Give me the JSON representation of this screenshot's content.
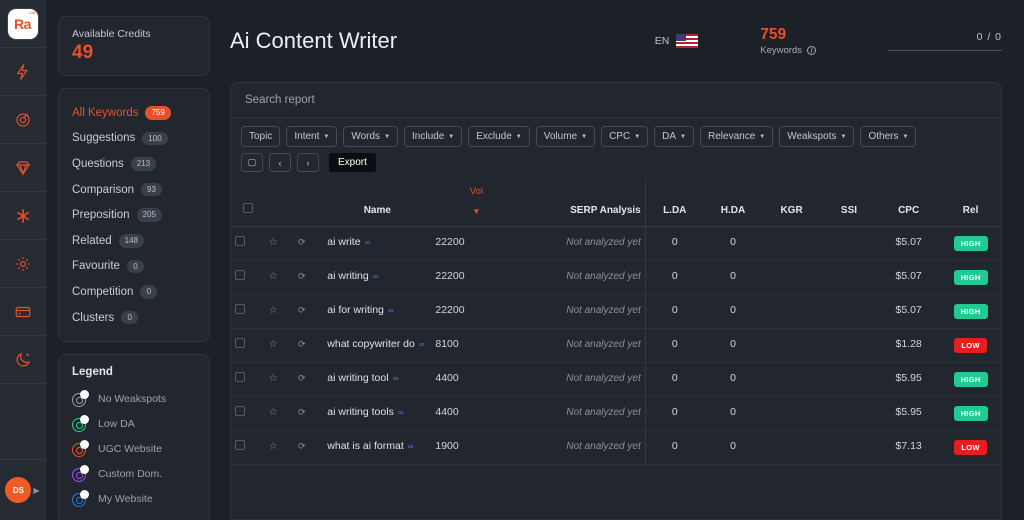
{
  "rail": {
    "logo_text": "Ra",
    "logo_sup": "LAB",
    "avatar_initials": "DS",
    "icons": [
      "bolt-icon",
      "target-icon",
      "diamond-icon",
      "asterisk-icon",
      "gear-icon",
      "card-icon",
      "moon-icon"
    ]
  },
  "credits": {
    "label": "Available Credits",
    "value": "49"
  },
  "nav": {
    "items": [
      {
        "label": "All Keywords",
        "count": "759",
        "active": true
      },
      {
        "label": "Suggestions",
        "count": "100",
        "active": false
      },
      {
        "label": "Questions",
        "count": "213",
        "active": false
      },
      {
        "label": "Comparison",
        "count": "93",
        "active": false
      },
      {
        "label": "Preposition",
        "count": "205",
        "active": false
      },
      {
        "label": "Related",
        "count": "148",
        "active": false
      },
      {
        "label": "Favourite",
        "count": "0",
        "active": false
      },
      {
        "label": "Competition",
        "count": "0",
        "active": false
      },
      {
        "label": "Clusters",
        "count": "0",
        "active": false
      }
    ]
  },
  "legend": {
    "title": "Legend",
    "items": [
      {
        "label": "No Weakspots",
        "color": "#9aa0a8",
        "letter": "0"
      },
      {
        "label": "Low DA",
        "color": "#1fd68f",
        "letter": "0"
      },
      {
        "label": "UGC Website",
        "color": "#f0502a",
        "letter": "0"
      },
      {
        "label": "Custom Dom.",
        "color": "#9b4ff5",
        "letter": "0"
      },
      {
        "label": "My Website",
        "color": "#2f6fe0",
        "letter": "0"
      }
    ]
  },
  "header": {
    "title": "Ai Content Writer",
    "lang_code": "EN",
    "flag": "us-flag-icon",
    "keywords_count": "759",
    "keywords_label": "Keywords",
    "progress_text": "0 / 0"
  },
  "search": {
    "placeholder": "Search report"
  },
  "filters": [
    {
      "label": "Topic",
      "caret": false
    },
    {
      "label": "Intent",
      "caret": true
    },
    {
      "label": "Words",
      "caret": true
    },
    {
      "label": "Include",
      "caret": true
    },
    {
      "label": "Exclude",
      "caret": true
    },
    {
      "label": "Volume",
      "caret": true
    },
    {
      "label": "CPC",
      "caret": true
    },
    {
      "label": "DA",
      "caret": true
    },
    {
      "label": "Relevance",
      "caret": true
    },
    {
      "label": "Weakspots",
      "caret": true
    },
    {
      "label": "Others",
      "caret": true
    }
  ],
  "toolbar": {
    "copy_icon": "clipboard-icon",
    "prev_icon": "chevron-left-icon",
    "next_icon": "chevron-right-icon",
    "export_label": "Export"
  },
  "table": {
    "columns": {
      "name": "Name",
      "vol": "Vol",
      "vol_arrow": "▼",
      "serp": "SERP Analysis",
      "lda": "L.DA",
      "hda": "H.DA",
      "kgr": "KGR",
      "ssi": "SSI",
      "cpc": "CPC",
      "rel": "Rel"
    },
    "rows": [
      {
        "name": "ai write",
        "vol": "22200",
        "serp": "Not analyzed yet",
        "lda": "0",
        "hda": "0",
        "kgr": "",
        "ssi": "",
        "cpc": "$5.07",
        "rel": "HIGH",
        "rel_kind": "high"
      },
      {
        "name": "ai writing",
        "vol": "22200",
        "serp": "Not analyzed yet",
        "lda": "0",
        "hda": "0",
        "kgr": "",
        "ssi": "",
        "cpc": "$5.07",
        "rel": "HIGH",
        "rel_kind": "high"
      },
      {
        "name": "ai for writing",
        "vol": "22200",
        "serp": "Not analyzed yet",
        "lda": "0",
        "hda": "0",
        "kgr": "",
        "ssi": "",
        "cpc": "$5.07",
        "rel": "HIGH",
        "rel_kind": "high"
      },
      {
        "name": "what copywriter do",
        "vol": "8100",
        "serp": "Not analyzed yet",
        "lda": "0",
        "hda": "0",
        "kgr": "",
        "ssi": "",
        "cpc": "$1.28",
        "rel": "LOW",
        "rel_kind": "low"
      },
      {
        "name": "ai writing tool",
        "vol": "4400",
        "serp": "Not analyzed yet",
        "lda": "0",
        "hda": "0",
        "kgr": "",
        "ssi": "",
        "cpc": "$5.95",
        "rel": "HIGH",
        "rel_kind": "high"
      },
      {
        "name": "ai writing tools",
        "vol": "4400",
        "serp": "Not analyzed yet",
        "lda": "0",
        "hda": "0",
        "kgr": "",
        "ssi": "",
        "cpc": "$5.95",
        "rel": "HIGH",
        "rel_kind": "high"
      },
      {
        "name": "what is ai format",
        "vol": "1900",
        "serp": "Not analyzed yet",
        "lda": "0",
        "hda": "0",
        "kgr": "",
        "ssi": "",
        "cpc": "$7.13",
        "rel": "LOW",
        "rel_kind": "low"
      }
    ]
  }
}
